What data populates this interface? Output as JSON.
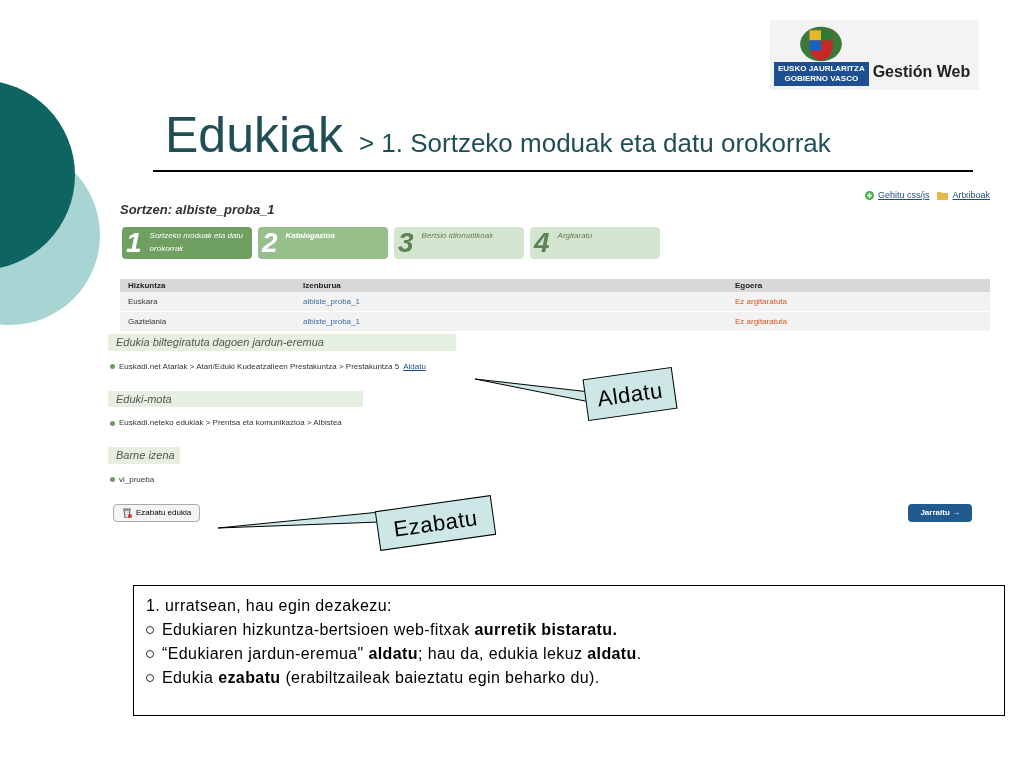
{
  "logo": {
    "line_1": "EUSKO JAURLARITZA",
    "line_2": "GOBIERNO VASCO",
    "product": "Gestión Web"
  },
  "slide_title": {
    "main": "Edukiak",
    "sub": "> 1. Sortzeko moduak eta datu orokorrak"
  },
  "screen": {
    "links": [
      "Gehitu css/js",
      "Artxiboak"
    ],
    "heading": "Sortzen: albiste_proba_1",
    "steps": [
      {
        "number": "1",
        "label": "Sortzeko moduak eta datu orokorrak",
        "selected": true,
        "disabled": false
      },
      {
        "number": "2",
        "label": "Katalogazioa",
        "selected": false,
        "disabled": false
      },
      {
        "number": "3",
        "label": "Bertsio idiomatikoak",
        "selected": false,
        "disabled": true
      },
      {
        "number": "4",
        "label": "Argitaratu",
        "selected": false,
        "disabled": true
      }
    ],
    "table": {
      "columns": [
        "Hizkuntza",
        "Izenburua",
        "Egoera"
      ],
      "rows": [
        [
          "Euskara",
          "albiste_proba_1",
          "Ez argitaratuta"
        ],
        [
          "Gaztelania",
          "albiste_proba_1",
          "Ez argitaratuta"
        ]
      ]
    },
    "sections": [
      {
        "title": "Edukia biltegiratuta dagoen jardun-eremua",
        "value": "Euskadi.net Atariak > Atari/Eduki Kudeatzaileen Prestakuntza > Prestakuntza 5",
        "link": "Aldatu"
      },
      {
        "title": "Eduki-mota",
        "value": "Euskadi.neteko edukiak > Prentsa eta komunikazioa > Albistea"
      },
      {
        "title": "Barne izena",
        "value": "vi_prueba"
      }
    ],
    "delete_button": "Ezabatu edukia",
    "next_button": "Jarraitu →"
  },
  "callouts": [
    "Aldatu",
    "Ezabatu"
  ],
  "notes": {
    "intro": "1. urratsean, hau egin dezakezu:",
    "bullets": [
      "Edukiaren hizkuntza-bertsioen web-fitxak **aurretik bistaratu.**",
      "“Edukiaren jardun-eremua\" **aldatu**; hau da, edukia lekuz **aldatu**.",
      "Edukia **ezabatu** (erabiltzaileak baieztatu egin beharko du)."
    ]
  }
}
